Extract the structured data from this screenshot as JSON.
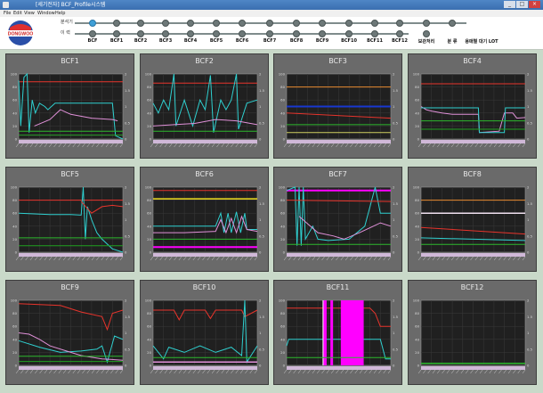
{
  "window": {
    "title": "[세기전자] BCF_Profile시스템"
  },
  "menu": [
    "File",
    "Edit",
    "View",
    "Window",
    "Help"
  ],
  "header": {
    "row1_label": "분석기",
    "row2_label": "이 력",
    "logo_text": "DONGWOO",
    "columns": [
      "BCF",
      "BCF1",
      "BCF2",
      "BCF3",
      "BCF4",
      "BCF5",
      "BCF6",
      "BCF7",
      "BCF8",
      "BCF9",
      "BCF10",
      "BCF11",
      "BCF12",
      "보관처리",
      "분 류",
      "용매별 대기 LOT"
    ]
  },
  "panels": [
    {
      "title": "BCF1"
    },
    {
      "title": "BCF2"
    },
    {
      "title": "BCF3"
    },
    {
      "title": "BCF4"
    },
    {
      "title": "BCF5"
    },
    {
      "title": "BCF6"
    },
    {
      "title": "BCF7"
    },
    {
      "title": "BCF8"
    },
    {
      "title": "BCF9"
    },
    {
      "title": "BCF10"
    },
    {
      "title": "BCF11"
    },
    {
      "title": "BCF12"
    }
  ],
  "axis": {
    "left_ticks": [
      "100",
      "80",
      "60",
      "40",
      "20",
      "0"
    ],
    "right_ticks": [
      "2",
      "1.5",
      "1",
      "0.5",
      "0"
    ]
  },
  "colors": {
    "red": "#e8342c",
    "cyan": "#2fd0d0",
    "pink": "#e090d8",
    "green": "#2db82d",
    "yellow": "#f0e020",
    "blue": "#1838d0",
    "magenta": "#ff00ff",
    "orange": "#e88a30"
  }
}
